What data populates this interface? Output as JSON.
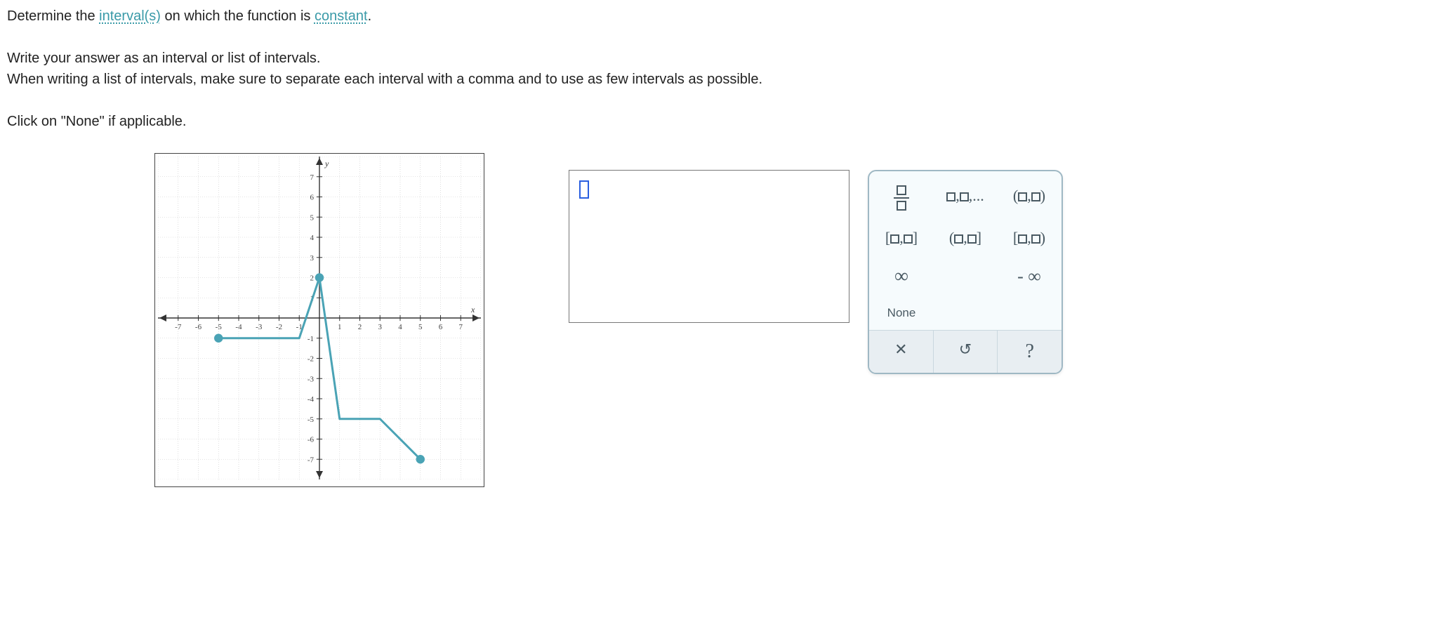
{
  "question": {
    "line1_pre": "Determine the ",
    "line1_link1": "interval(s)",
    "line1_mid": " on which the function is ",
    "line1_link2": "constant",
    "line1_post": ".",
    "line2": "Write your answer as an interval or list of intervals.",
    "line3": "When writing a list of intervals, make sure to separate each interval with a comma and to use as few intervals as possible.",
    "line4": "Click on \"None\" if applicable."
  },
  "answer_value": "",
  "palette": {
    "list_label": "▢,▢,...",
    "open_open": "(▢,▢)",
    "closed_closed": "[▢,▢]",
    "open_closed": "(▢,▢]",
    "closed_open": "[▢,▢)",
    "infinity": "∞",
    "neg_infinity": "- ∞",
    "none": "None",
    "clear": "✕",
    "undo": "↺",
    "help": "?"
  },
  "chart_data": {
    "type": "line",
    "xlabel": "x",
    "ylabel": "y",
    "xlim": [
      -8,
      8
    ],
    "ylim": [
      -8,
      8
    ],
    "xticks": [
      -7,
      -6,
      -5,
      -4,
      -3,
      -2,
      -1,
      1,
      2,
      3,
      4,
      5,
      6,
      7
    ],
    "yticks": [
      -7,
      -6,
      -5,
      -4,
      -3,
      -2,
      -1,
      1,
      2,
      3,
      4,
      5,
      6,
      7
    ],
    "segments": [
      {
        "points": [
          [
            -5,
            -1
          ],
          [
            -1,
            -1
          ],
          [
            0,
            2
          ],
          [
            1,
            -5
          ],
          [
            2,
            -5
          ],
          [
            3,
            -5
          ],
          [
            5,
            -7
          ]
        ]
      }
    ],
    "endpoints": [
      {
        "x": -5,
        "y": -1,
        "filled": true
      },
      {
        "x": 0,
        "y": 2,
        "filled": true
      },
      {
        "x": 5,
        "y": -7,
        "filled": true
      }
    ]
  }
}
